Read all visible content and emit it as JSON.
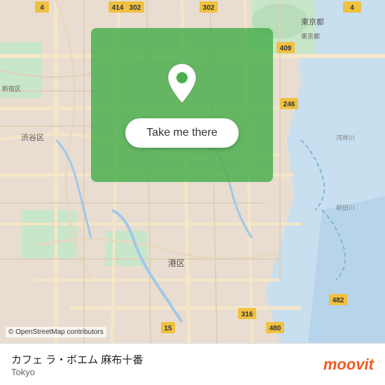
{
  "map": {
    "credit": "© OpenStreetMap contributors",
    "background_color": "#e8ddd0"
  },
  "overlay": {
    "button_label": "Take me there"
  },
  "bottom_bar": {
    "location_name": "カフェ ラ・ボエム 麻布十番",
    "location_city": "Tokyo",
    "moovit_logo": "moovit"
  }
}
